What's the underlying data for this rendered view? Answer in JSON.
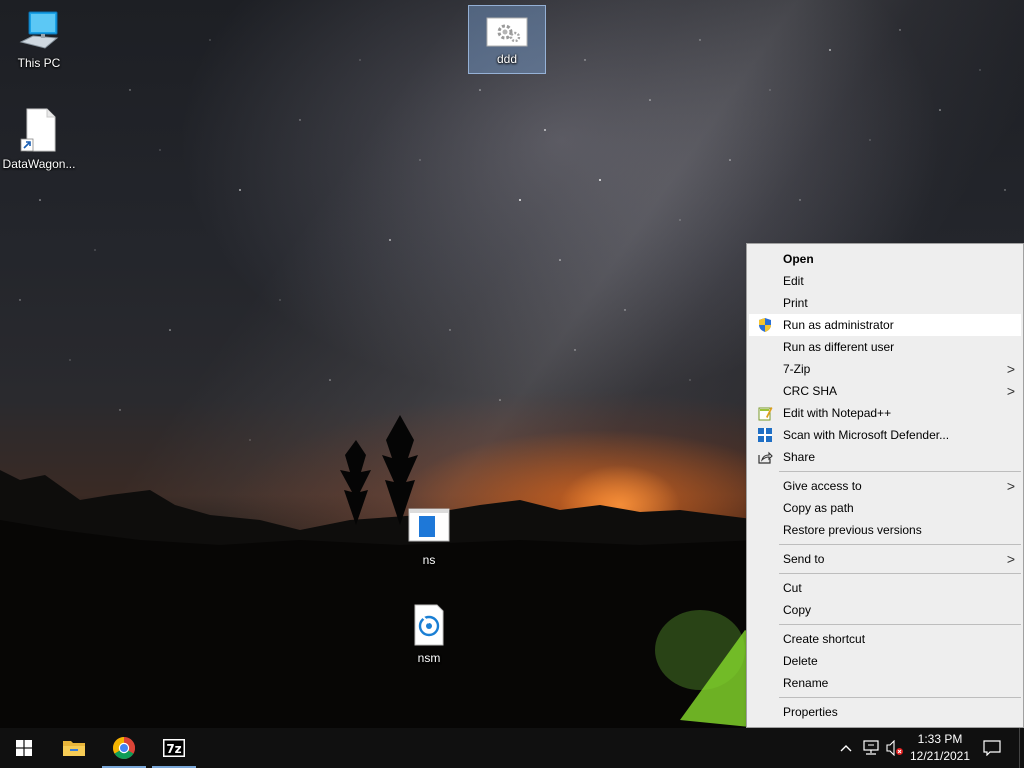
{
  "desktop": {
    "icons": [
      {
        "label": "This PC",
        "icon": "computer-icon"
      },
      {
        "label": "DataWagon...",
        "icon": "file-shortcut-icon"
      },
      {
        "label": "ddd",
        "icon": "gear-file-icon"
      },
      {
        "label": "ns",
        "icon": "window-app-icon"
      },
      {
        "label": "nsm",
        "icon": "setup-file-icon"
      }
    ]
  },
  "context_menu": {
    "groups": [
      [
        {
          "label": "Open",
          "bold": true
        },
        {
          "label": "Edit"
        },
        {
          "label": "Print"
        },
        {
          "label": "Run as administrator",
          "icon": "uac-shield-icon",
          "highlighted": true
        },
        {
          "label": "Run as different user"
        },
        {
          "label": "7-Zip",
          "submenu": true
        },
        {
          "label": "CRC SHA",
          "submenu": true
        },
        {
          "label": "Edit with Notepad++",
          "icon": "notepad-plus-plus-icon"
        },
        {
          "label": "Scan with Microsoft Defender...",
          "icon": "defender-icon"
        },
        {
          "label": "Share",
          "icon": "share-icon"
        }
      ],
      [
        {
          "label": "Give access to",
          "submenu": true
        },
        {
          "label": "Copy as path"
        },
        {
          "label": "Restore previous versions"
        }
      ],
      [
        {
          "label": "Send to",
          "submenu": true
        }
      ],
      [
        {
          "label": "Cut"
        },
        {
          "label": "Copy"
        }
      ],
      [
        {
          "label": "Create shortcut"
        },
        {
          "label": "Delete"
        },
        {
          "label": "Rename"
        }
      ],
      [
        {
          "label": "Properties"
        }
      ]
    ],
    "submenu_arrow": ">"
  },
  "taskbar": {
    "buttons": [
      {
        "name": "start-button",
        "icon": "windows-logo-icon"
      },
      {
        "name": "file-explorer-button",
        "icon": "folder-icon"
      },
      {
        "name": "chrome-button",
        "icon": "chrome-icon",
        "active": true
      },
      {
        "name": "7zip-button",
        "icon": "7zip-icon",
        "active": true
      }
    ],
    "tray": {
      "chevron": "^",
      "time": "1:33 PM",
      "date": "12/21/2021"
    }
  },
  "colors": {
    "menu_bg": "#eeeeee",
    "menu_highlight": "#ffffff",
    "taskbar_bg": "#101010",
    "selection": "#78a0d2"
  }
}
